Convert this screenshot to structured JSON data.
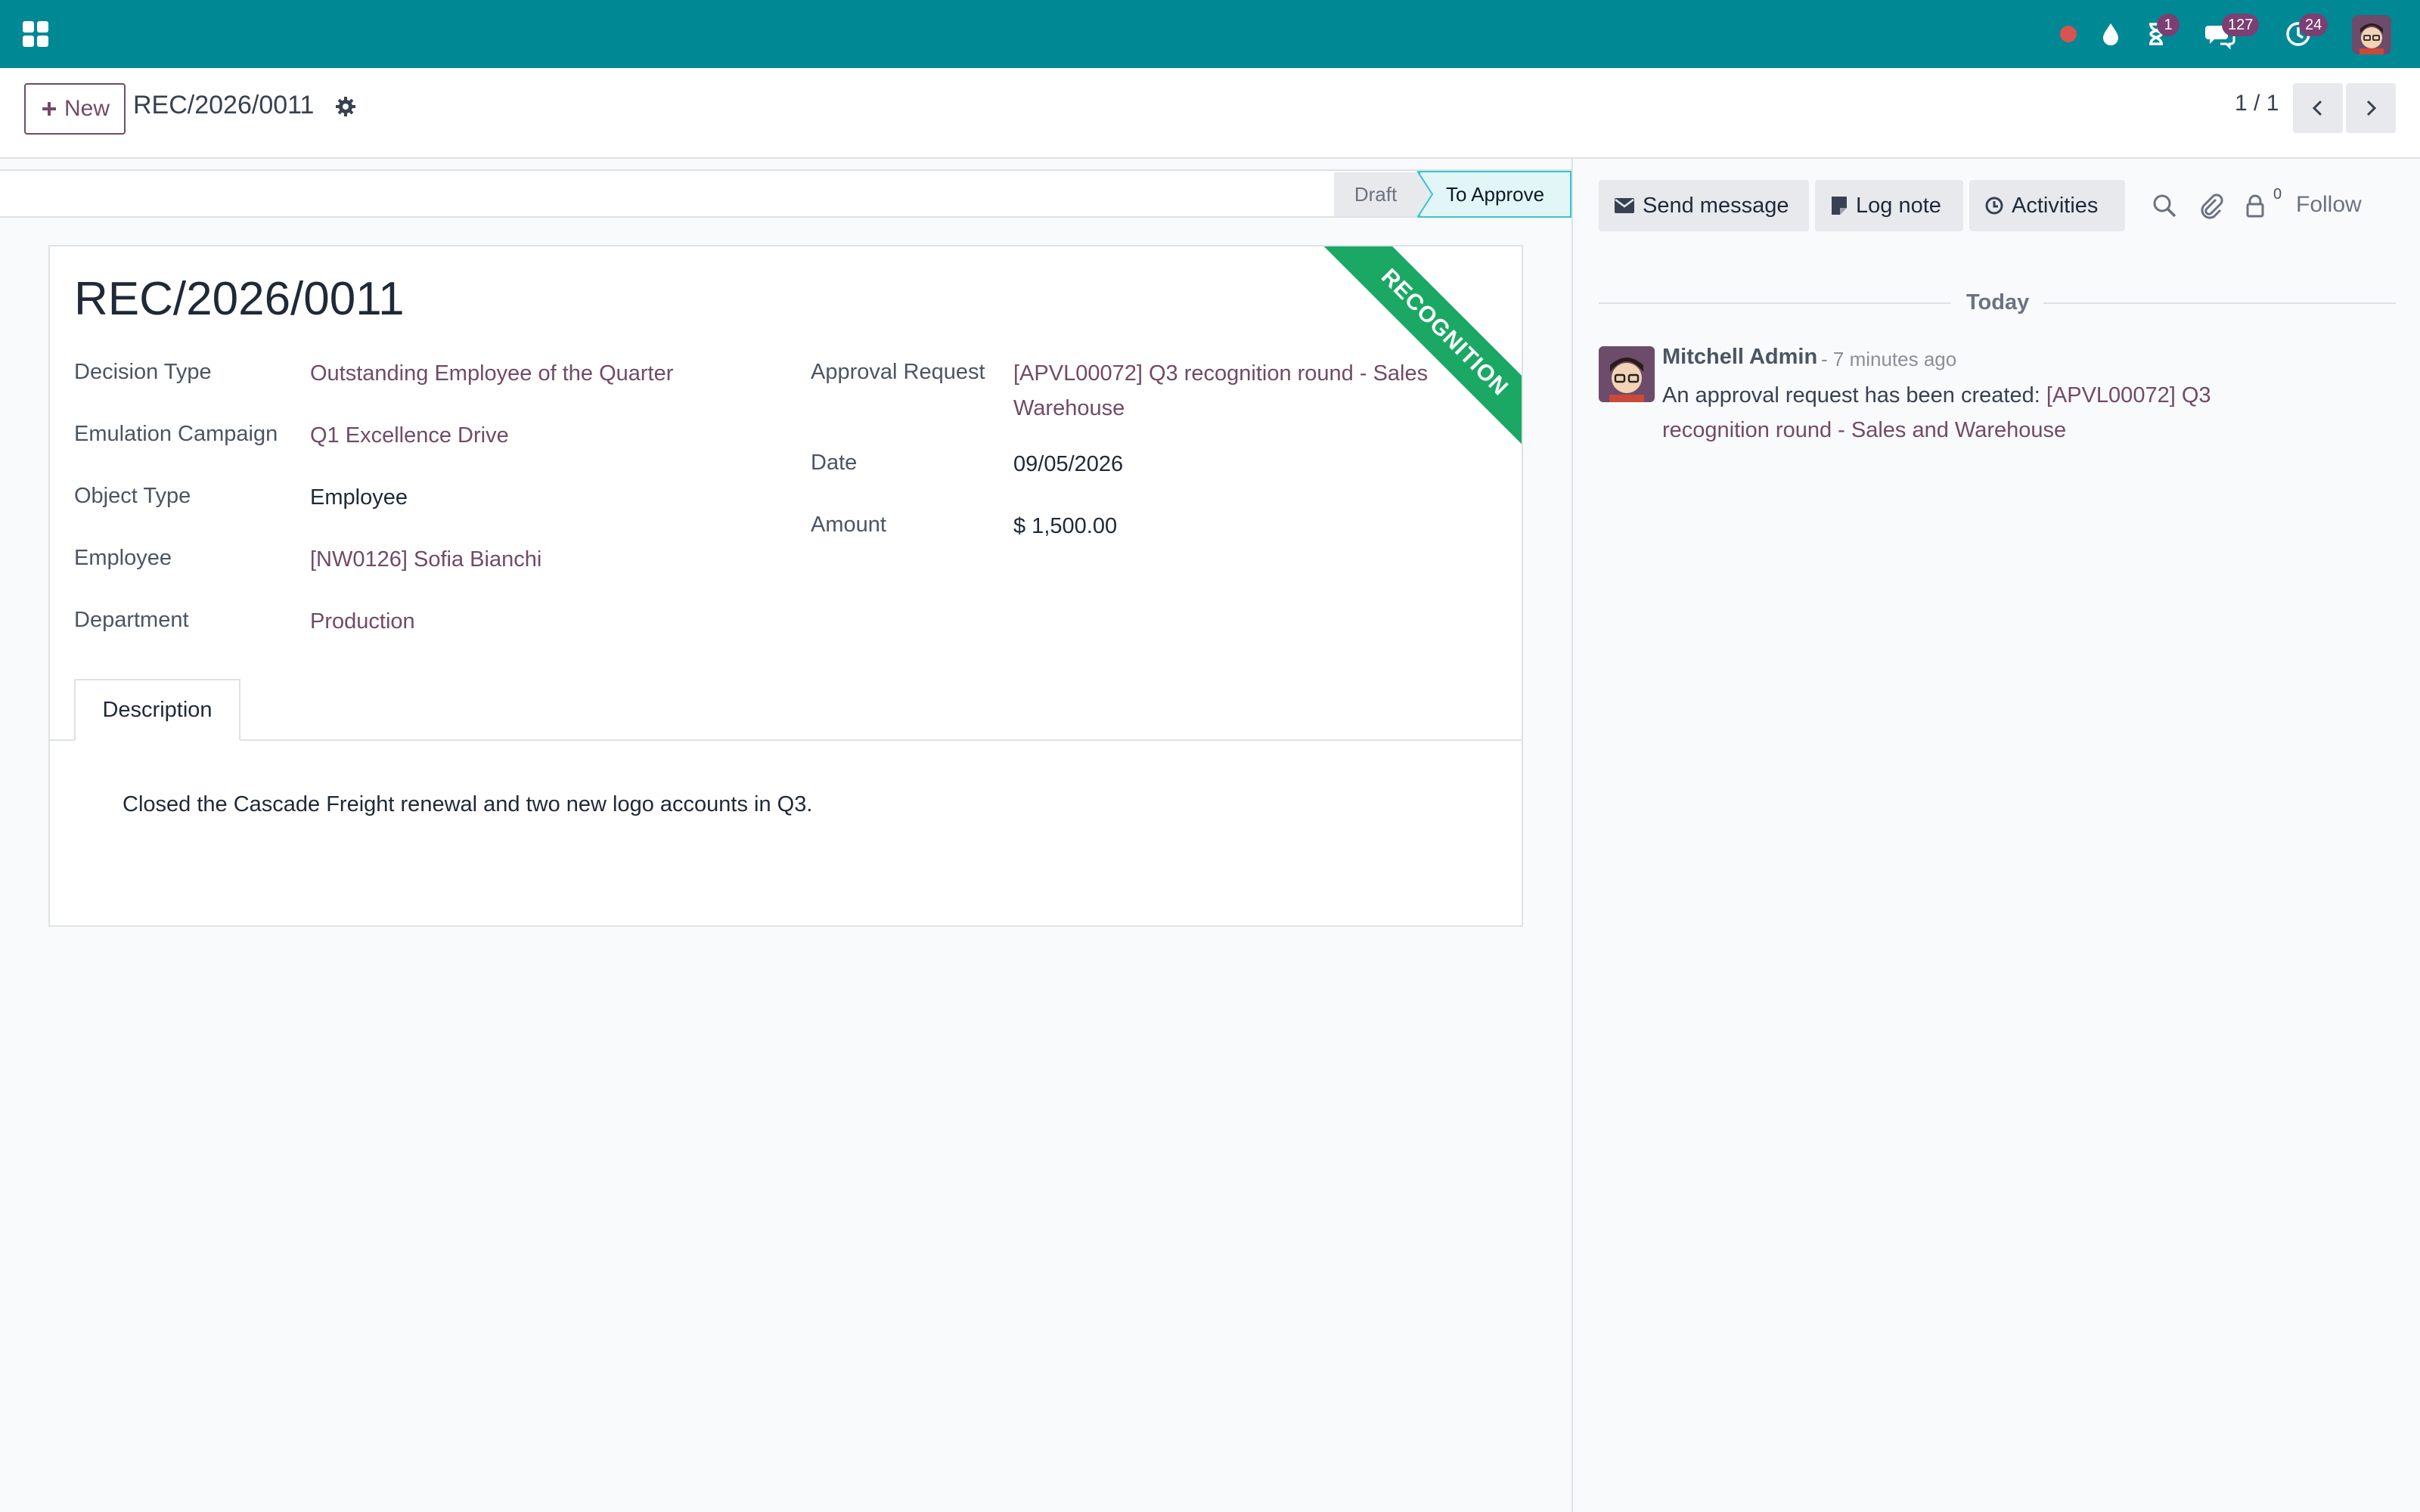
{
  "navbar": {
    "icons": [
      "apps-icon",
      "record-dot-icon",
      "drop-icon",
      "hourglass-icon",
      "chat-icon",
      "clock-icon",
      "user-avatar"
    ],
    "badges": {
      "activities": "1",
      "messages": "127",
      "clock": "24"
    },
    "color": "#018895"
  },
  "control": {
    "new_label": "New",
    "title": "REC/2026/0011",
    "pager": "1 / 1"
  },
  "status": {
    "stages": [
      "Draft",
      "To Approve"
    ],
    "current": "To Approve"
  },
  "form": {
    "title": "REC/2026/0011",
    "ribbon": "RECOGNITION",
    "left": [
      {
        "label": "Decision Type",
        "value": "Outstanding Employee of the Quarter",
        "link": true
      },
      {
        "label": "Emulation Campaign",
        "value": "Q1 Excellence Drive",
        "link": true
      },
      {
        "label": "Object Type",
        "value": "Employee",
        "link": false
      },
      {
        "label": "Employee",
        "value": "[NW0126] Sofia Bianchi",
        "link": true
      },
      {
        "label": "Department",
        "value": "Production",
        "link": true
      }
    ],
    "right": [
      {
        "label": "Approval Request",
        "value_line1": "[APVL00072] Q3 recognition round - Sales",
        "value_line2": "Warehouse",
        "link": true
      },
      {
        "label": "Date",
        "value": "09/05/2026",
        "link": false
      },
      {
        "label": "Amount",
        "value": "$ 1,500.00",
        "link": false
      }
    ],
    "tab": "Description",
    "description": "Closed the Cascade Freight renewal and two new logo accounts in Q3."
  },
  "chatter": {
    "send_message": "Send message",
    "log_note": "Log note",
    "activities": "Activities",
    "follower_count": "0",
    "follow": "Follow",
    "today": "Today",
    "message": {
      "author": "Mitchell Admin",
      "time": "- 7 minutes ago",
      "body_prefix": "An approval request has been created: ",
      "body_link_line1": "[APVL00072] Q3",
      "body_link_line2": "recognition round - Sales and Warehouse"
    }
  },
  "colors": {
    "brand": "#018895",
    "link": "#714b67",
    "ribbon": "#1ba864",
    "stage_active": "#39c3d3"
  }
}
